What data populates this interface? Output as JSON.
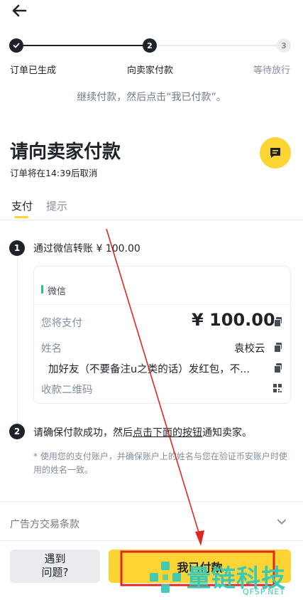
{
  "stepper": {
    "steps": [
      {
        "number": "1",
        "label": "订单已生成",
        "state": "done"
      },
      {
        "number": "2",
        "label": "向卖家付款",
        "state": "current"
      },
      {
        "number": "3",
        "label": "等待放行",
        "state": "pending"
      }
    ]
  },
  "hint": "继续付款，然后点击“我已付款”。",
  "header": {
    "title": "请向卖家付款",
    "subtitle": "订单将在14:39后取消"
  },
  "tabs": [
    {
      "label": "支付",
      "active": true
    },
    {
      "label": "提示",
      "active": false
    }
  ],
  "steps": {
    "step1": {
      "number": "1",
      "text": "通过微信转账 ¥ 100.00"
    },
    "step2": {
      "number": "2",
      "text_before": "请确保付款成功，然后",
      "text_link": "点击下面的按钮",
      "text_after": "通知卖家。"
    }
  },
  "payment_card": {
    "method": "微信",
    "rows": [
      {
        "label": "您将支付",
        "value": "¥ 100.00"
      },
      {
        "label": "姓名",
        "value": "袁校云"
      },
      {
        "label": "",
        "value": "加好友（不要备注u之类的话）发红包，不..."
      },
      {
        "label": "收款二维码",
        "value": ""
      }
    ]
  },
  "note": "* 使用您的支付账户，并确保账户上的姓名与您在验证币安账户时使用的姓名一致。",
  "terms": {
    "label": "广告方交易条款"
  },
  "footer": {
    "problem_label_line1": "遇到",
    "problem_label_line2": "问题?",
    "paid_label": "我已付款"
  },
  "watermark": {
    "brand": "量链科技",
    "url": "QFSP.NET"
  },
  "colors": {
    "accent": "#FCD535",
    "text": "#1E2329",
    "muted": "#848E9C",
    "wechat": "#2EBD85",
    "annotation": "#E0281E"
  }
}
